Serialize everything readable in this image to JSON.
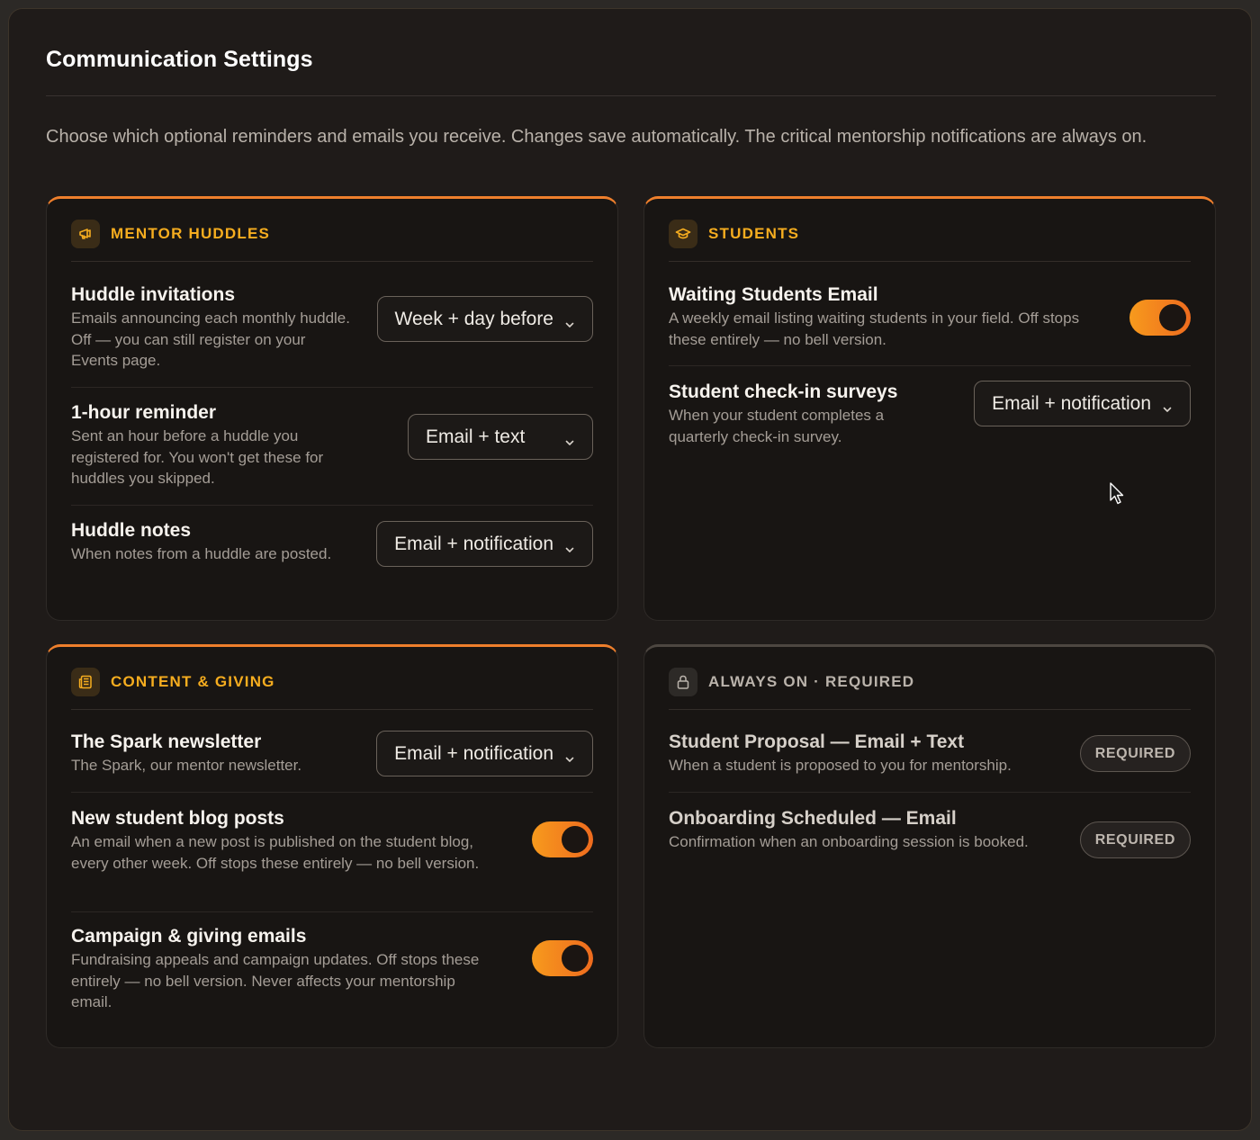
{
  "page": {
    "title": "Communication Settings",
    "intro": "Choose which optional reminders and emails you receive. Changes save automatically. The critical mentorship notifications are always on."
  },
  "colors": {
    "accent": "#ee7f2c",
    "accent_text": "#f6ad1f",
    "background": "#1f1b19"
  },
  "sections": {
    "mentor_huddles": {
      "title": "MENTOR HUDDLES",
      "icon": "megaphone-icon",
      "rows": [
        {
          "title": "Huddle invitations",
          "desc": "Emails announcing each monthly huddle. Off — you can still register on your Events page.",
          "value": "Week + day before"
        },
        {
          "title": "1-hour reminder",
          "desc": "Sent an hour before a huddle you registered for. You won't get these for huddles you skipped.",
          "value": "Email + text"
        },
        {
          "title": "Huddle notes",
          "desc": "When notes from a huddle are posted.",
          "value": "Email + notification"
        }
      ]
    },
    "students": {
      "title": "STUDENTS",
      "icon": "graduation-cap-icon",
      "rows": [
        {
          "title": "Waiting Students Email",
          "desc": "A weekly email listing waiting students in your field. Off stops these entirely — no bell version.",
          "toggle_on": true
        },
        {
          "title": "Student check-in surveys",
          "desc": "When your student completes a quarterly check-in survey.",
          "value": "Email + notification"
        }
      ]
    },
    "content_giving": {
      "title": "CONTENT & GIVING",
      "icon": "newspaper-icon",
      "rows": [
        {
          "title": "The Spark newsletter",
          "desc": "The Spark, our mentor newsletter.",
          "value": "Email + notification"
        },
        {
          "title": "New student blog posts",
          "desc": "An email when a new post is published on the student blog, every other week. Off stops these entirely — no bell version.",
          "toggle_on": true
        },
        {
          "title": "Campaign & giving emails",
          "desc": "Fundraising appeals and campaign updates. Off stops these entirely — no bell version. Never affects your mentorship email.",
          "toggle_on": true
        }
      ]
    },
    "always_on": {
      "title": "ALWAYS ON · REQUIRED",
      "icon": "lock-icon",
      "rows": [
        {
          "title": "Student Proposal — Email + Text",
          "desc": "When a student is proposed to you for mentorship.",
          "badge": "REQUIRED"
        },
        {
          "title": "Onboarding Scheduled — Email",
          "desc": "Confirmation when an onboarding session is booked.",
          "badge": "REQUIRED"
        }
      ]
    }
  }
}
